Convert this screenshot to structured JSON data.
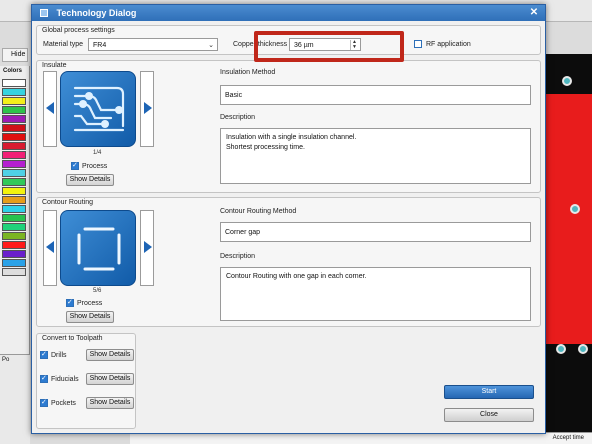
{
  "dialog": {
    "title": "Technology Dialog",
    "close_glyph": "✕"
  },
  "background": {
    "hide_label": "Hide",
    "colors_label": "Colors",
    "swatches": [
      "#ffffff",
      "#36d3e0",
      "#f3ef1b",
      "#2ec34a",
      "#9e1bb4",
      "#d0101a",
      "#e01010",
      "#d81b30",
      "#f21f76",
      "#b51fd0",
      "#4fd1e6",
      "#31c95a",
      "#f3f30f",
      "#e69d1a",
      "#2fd0e9",
      "#28c24e",
      "#1fd27b",
      "#7bb522",
      "#ff1a1a",
      "#6a1fcc",
      "#2aa2e8",
      "#ddd"
    ],
    "bottom_left_label": "Po",
    "bottom_status": "Accept time"
  },
  "global_settings": {
    "title": "Global process settings",
    "material_label": "Material type",
    "material_value": "FR4",
    "copper_label": "Copper thickness",
    "copper_value": "36 µm",
    "rf_label": "RF application",
    "rf_checked": false
  },
  "insulate": {
    "title": "Insulate",
    "counter": "1/4",
    "process_label": "Process",
    "process_checked": true,
    "details_label": "Show Details",
    "method_label": "Insulation Method",
    "method_value": "Basic",
    "description_label": "Description",
    "description_lines": [
      "Insulation with a single insulation channel.",
      "Shortest processing time."
    ]
  },
  "contour": {
    "title": "Contour Routing",
    "counter": "5/6",
    "process_label": "Process",
    "process_checked": true,
    "details_label": "Show Details",
    "method_label": "Contour Routing Method",
    "method_value": "Corner gap",
    "description_label": "Description",
    "description_lines": [
      "Contour Routing with one gap in each corner."
    ]
  },
  "toolpath": {
    "title": "Convert to Toolpath",
    "items": [
      {
        "label": "Drills",
        "checked": true,
        "details_label": "Show Details"
      },
      {
        "label": "Fiducials",
        "checked": true,
        "details_label": "Show Details"
      },
      {
        "label": "Pockets",
        "checked": true,
        "details_label": "Show Details"
      }
    ]
  },
  "actions": {
    "start_label": "Start",
    "close_label": "Close"
  },
  "colors": {
    "accent": "#2d7bd1",
    "highlight": "#c0271a"
  }
}
